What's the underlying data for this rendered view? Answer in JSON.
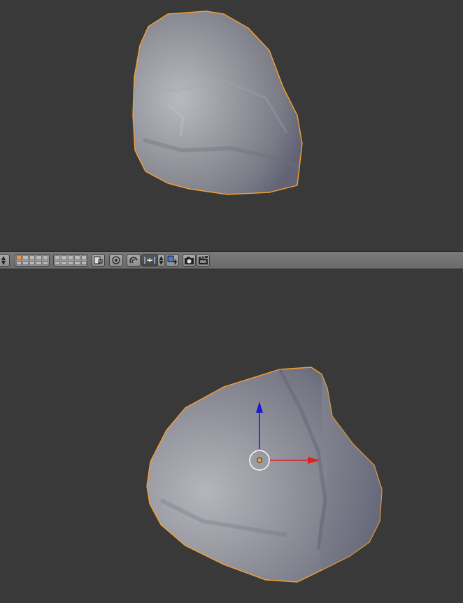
{
  "app": "Blender",
  "viewports": [
    {
      "name": "upper-3d-view",
      "object": "rock-mesh",
      "selected": true
    },
    {
      "name": "lower-3d-view",
      "object": "rock-mesh",
      "selected": true,
      "manipulator": "translate"
    }
  ],
  "header_toolbar": {
    "layer_buttons": 2,
    "icons": [
      "layer-grid-icon",
      "layer-grid-icon",
      "lock-layer-icon",
      "pivot-icon",
      "snap-magnet-icon",
      "snap-element-icon",
      "snap-target-icon",
      "render-camera-icon",
      "render-animation-icon"
    ]
  },
  "colors": {
    "viewport_bg": "#393939",
    "header_bg": "#727272",
    "selection_outline": "#f7a030",
    "axis_x": "#e02020",
    "axis_z": "#1818d8",
    "origin": "#f0a040"
  }
}
